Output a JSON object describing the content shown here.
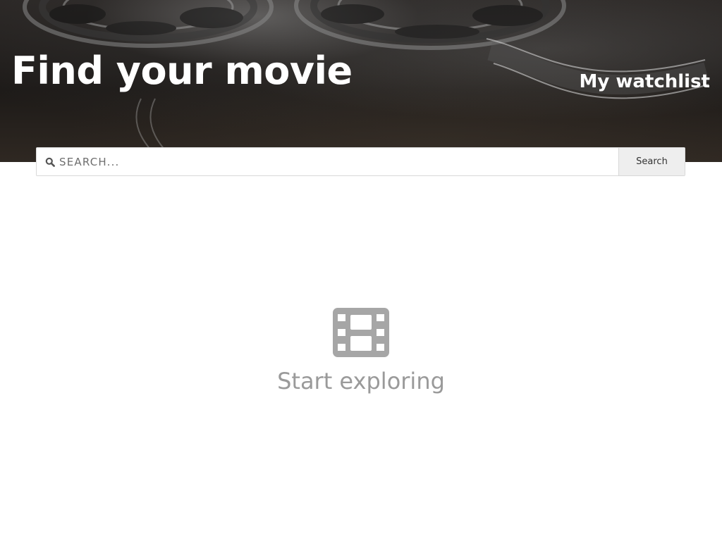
{
  "header": {
    "title": "Find your movie",
    "watchlist_label": "My watchlist"
  },
  "search": {
    "placeholder": "SEARCH...",
    "value": "",
    "button_label": "Search",
    "icon": "search-icon"
  },
  "empty_state": {
    "icon": "film-icon",
    "message": "Start exploring"
  },
  "colors": {
    "empty_text": "#9a9a9a",
    "icon_gray": "#a6a6a6",
    "button_bg": "#eeeeee"
  }
}
